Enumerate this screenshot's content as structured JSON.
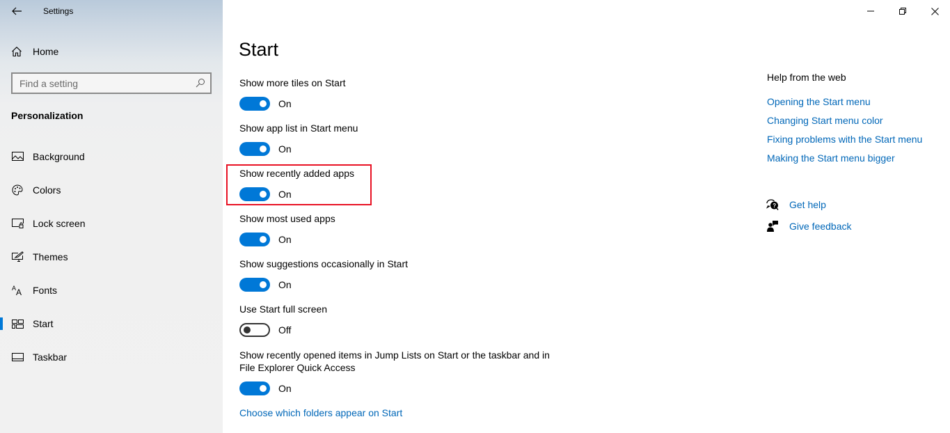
{
  "window": {
    "title": "Settings",
    "controls": [
      "minimize",
      "restore",
      "close"
    ]
  },
  "sidebar": {
    "home_label": "Home",
    "search": {
      "placeholder": "Find a setting",
      "value": ""
    },
    "section_title": "Personalization",
    "items": [
      {
        "label": "Background",
        "icon": "image-icon",
        "selected": false
      },
      {
        "label": "Colors",
        "icon": "palette-icon",
        "selected": false
      },
      {
        "label": "Lock screen",
        "icon": "lock-screen-icon",
        "selected": false
      },
      {
        "label": "Themes",
        "icon": "themes-icon",
        "selected": false
      },
      {
        "label": "Fonts",
        "icon": "fonts-icon",
        "selected": false
      },
      {
        "label": "Start",
        "icon": "start-tiles-icon",
        "selected": true
      },
      {
        "label": "Taskbar",
        "icon": "taskbar-icon",
        "selected": false
      }
    ]
  },
  "main": {
    "title": "Start",
    "settings": [
      {
        "label": "Show more tiles on Start",
        "state": "On",
        "on": true
      },
      {
        "label": "Show app list in Start menu",
        "state": "On",
        "on": true
      },
      {
        "label": "Show recently added apps",
        "state": "On",
        "on": true,
        "highlighted": true
      },
      {
        "label": "Show most used apps",
        "state": "On",
        "on": true
      },
      {
        "label": "Show suggestions occasionally in Start",
        "state": "On",
        "on": true
      },
      {
        "label": "Use Start full screen",
        "state": "Off",
        "on": false
      },
      {
        "label_line1": "Show recently opened items in Jump Lists on Start or the taskbar and in",
        "label_line2": "File Explorer Quick Access",
        "state": "On",
        "on": true
      }
    ],
    "folders_link": "Choose which folders appear on Start"
  },
  "help": {
    "title": "Help from the web",
    "links": [
      "Opening the Start menu",
      "Changing Start menu color",
      "Fixing problems with the Start menu",
      "Making the Start menu bigger"
    ],
    "get_help": "Get help",
    "give_feedback": "Give feedback"
  },
  "colors": {
    "accent": "#0078D7",
    "link": "#0067B8",
    "highlight_box": "#E81123"
  }
}
